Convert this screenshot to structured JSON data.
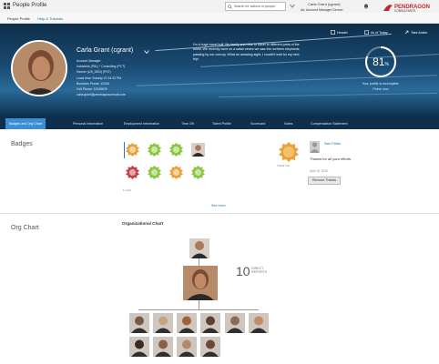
{
  "topbar": {
    "app_title": "People Profile",
    "search_placeholder": "Search for actions or people",
    "user_name": "Carla Grant (cgrant)",
    "user_role": "As: Account Manager  Denver",
    "logo_text": "PENDRAGON CONSULTANTS"
  },
  "subnav": {
    "items": [
      "People Profile",
      "Help & Tutorials"
    ]
  },
  "header": {
    "name": "Carla Grant (cgrant)",
    "info": [
      "Account Manager",
      "Industries (PAL) * Consulting (PCT)",
      "Denver (US_DEN) (PST)",
      "Local time: Sunday 07:24:32 PM",
      "Business Phone: 12345",
      "Cell Phone: 12345678",
      "carla.grant@pendragonconsult.com"
    ],
    "about": "I'm a huge travel buff. My family and I like to travel to different parts of the world. We recently went on a safari where we saw the northern elephants passing by our convoy. What an amazing sight, I couldn't wait for my next trip!",
    "buttons": {
      "header": "Header",
      "as_of_today": "As of Today",
      "take_action": "Take Action"
    },
    "completion": {
      "value": 81,
      "unit": "%",
      "caption": "Your profile is incomplete.",
      "link": "Finish now"
    }
  },
  "tabs": [
    "Badges and Org Chart",
    "Personal Information",
    "Employment Information",
    "Time Off",
    "Talent Profile",
    "Scorecard",
    "Notes",
    "Compensation Statement"
  ],
  "badges": {
    "title": "Badges",
    "caption": "1 more",
    "see_more": "See more",
    "thanks_caption": "Thank You",
    "thanks_user": "Sam Fields",
    "thanks_msg": "Thanks for all your efforts",
    "thanks_date": "April 15, 2016",
    "remove_label": "Remove Thanks"
  },
  "org": {
    "title": "Org Chart",
    "chart_title": "Organizational Chart",
    "reports_count": "10",
    "reports_label_1": "DIRECT",
    "reports_label_2": "REPORTS"
  },
  "colors": {
    "accent": "#3c8ed4",
    "banner": "#0f2f4d",
    "badge_orange": "#e9a23b",
    "badge_green": "#8cc63f",
    "badge_red": "#c1404a"
  }
}
